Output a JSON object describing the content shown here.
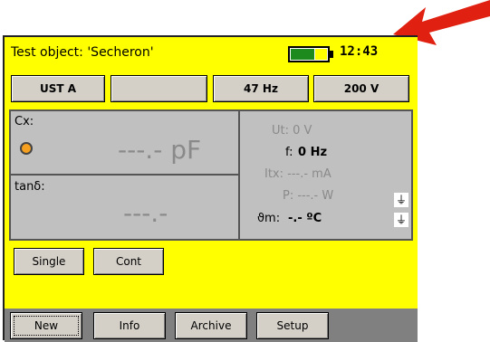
{
  "header": {
    "title": "Test object: 'Secheron'",
    "time": "12:43"
  },
  "top_buttons": [
    "UST A",
    "",
    "47 Hz",
    "200 V"
  ],
  "measure": {
    "cx_label": "Cx:",
    "cx_value": "---.- pF",
    "tan_label": "tanδ:",
    "tan_value": "---.-",
    "ut": "Ut: 0 V",
    "f_label": "f:",
    "f_value": "0 Hz",
    "itx": "Itx: ---.- mA",
    "p": "P: ---.- W",
    "theta_label": "ϑm:",
    "theta_value": "-.- ºC"
  },
  "mode_buttons": [
    "Single",
    "Cont"
  ],
  "bottom_buttons": [
    "New",
    "Info",
    "Archive",
    "Setup"
  ],
  "colors": {
    "accent": "#ffff00",
    "arrow": "#e02010",
    "battery": "#1c8a1c",
    "status_dot": "#f5a020"
  }
}
